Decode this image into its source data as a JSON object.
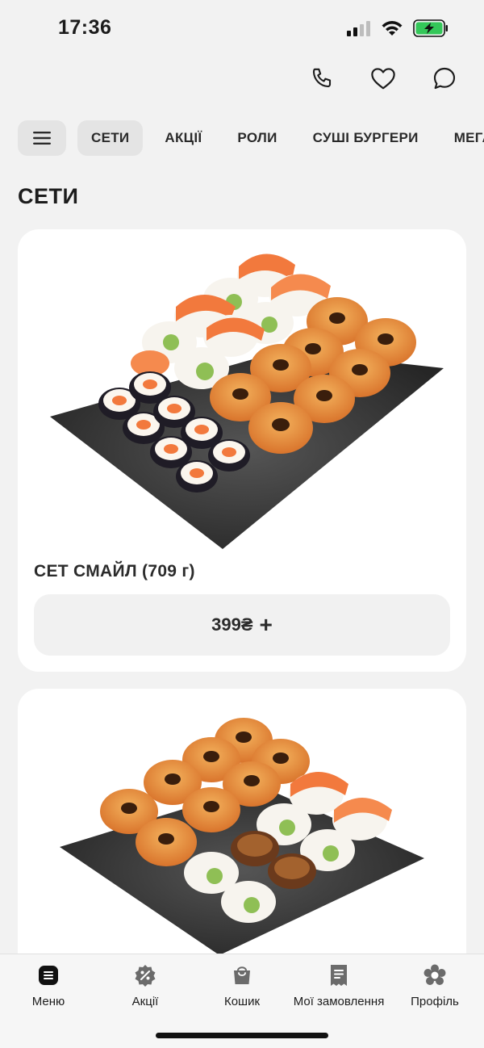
{
  "status_bar": {
    "time": "17:36"
  },
  "header": {
    "icons": [
      "phone-icon",
      "heart-icon",
      "chat-icon"
    ]
  },
  "categories": {
    "items": [
      {
        "label": "СЕТИ",
        "active": true
      },
      {
        "label": "АКЦІЇ",
        "active": false
      },
      {
        "label": "РОЛИ",
        "active": false
      },
      {
        "label": "СУШІ БУРГЕРИ",
        "active": false
      },
      {
        "label": "МЕГА",
        "active": false
      }
    ]
  },
  "section": {
    "title": "СЕТИ"
  },
  "products": [
    {
      "name": "СЕТ СМАЙЛ (709 г)",
      "price": "399₴",
      "add_symbol": "+"
    },
    {
      "name": "",
      "price": ""
    }
  ],
  "bottom_nav": {
    "items": [
      {
        "label": "Меню",
        "icon": "menu-list-icon"
      },
      {
        "label": "Акції",
        "icon": "percent-badge-icon"
      },
      {
        "label": "Кошик",
        "icon": "bag-icon"
      },
      {
        "label": "Мої замовлення",
        "icon": "receipt-icon"
      },
      {
        "label": "Профіль",
        "icon": "profile-flower-icon"
      }
    ]
  },
  "colors": {
    "background": "#f2f2f2",
    "card": "#ffffff",
    "chip": "#e4e4e4",
    "battery_green": "#34c759"
  }
}
